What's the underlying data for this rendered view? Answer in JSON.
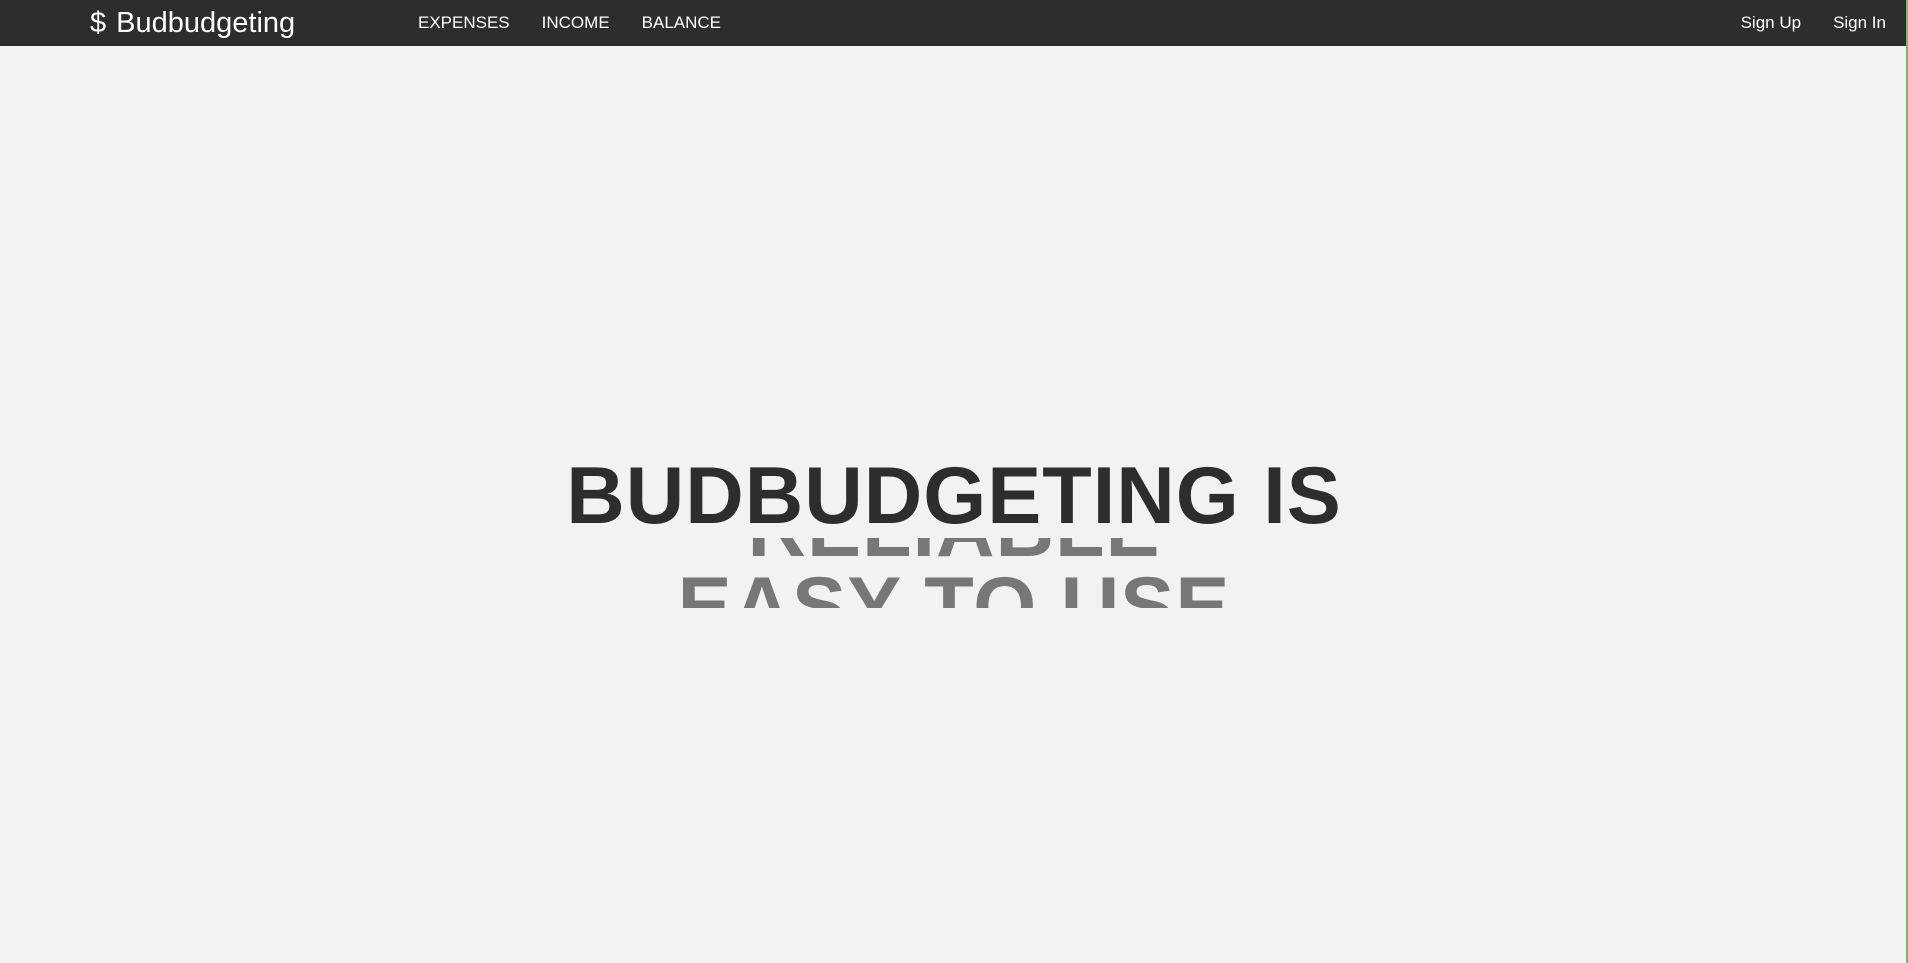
{
  "brand": {
    "icon": "dollar-icon",
    "icon_glyph": "$",
    "name": "Budbudgeting"
  },
  "nav": {
    "items": [
      {
        "label": "EXPENSES"
      },
      {
        "label": "INCOME"
      },
      {
        "label": "BALANCE"
      }
    ]
  },
  "auth": {
    "sign_up": "Sign Up",
    "sign_in": "Sign In"
  },
  "hero": {
    "title": "BUDBUDGETING IS",
    "rotating_words": [
      "RELIABLE",
      "EASY TO USE"
    ]
  },
  "colors": {
    "navbar": "#2d2d2d",
    "background": "#f2f2f2",
    "title": "#2d2d2d",
    "rotating_text": "#777777",
    "edge_accent": "#6fbf4a"
  }
}
